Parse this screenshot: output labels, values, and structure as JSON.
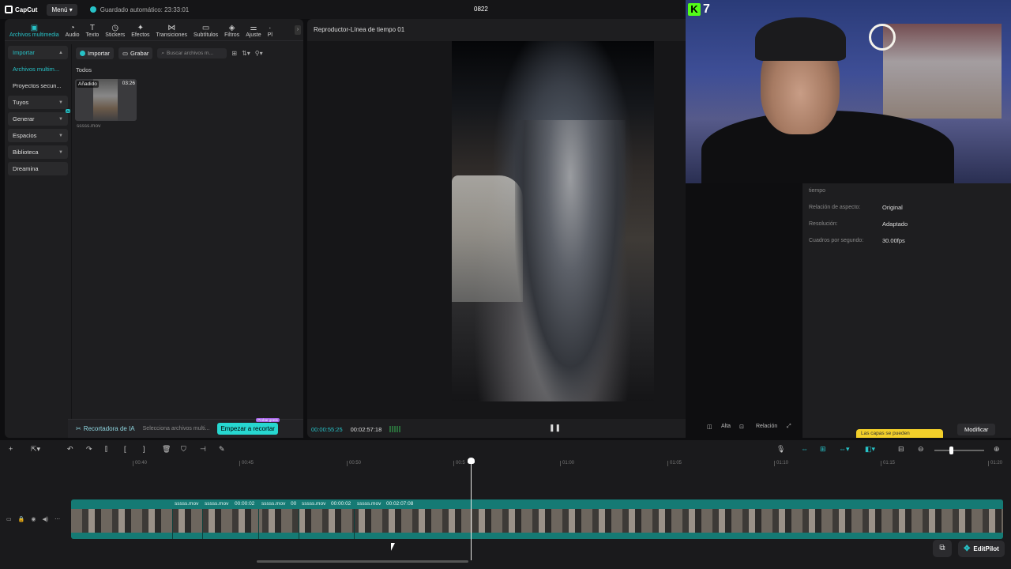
{
  "titlebar": {
    "logo": "CapCut",
    "menu": "Menú",
    "autosave": "Guardado automático: 23:33:01",
    "project": "0822"
  },
  "toolbar": {
    "items": [
      {
        "label": "Archivos multimedia",
        "icon": "media-icon"
      },
      {
        "label": "Audio",
        "icon": "audio-icon"
      },
      {
        "label": "Texto",
        "icon": "text-icon"
      },
      {
        "label": "Stickers",
        "icon": "sticker-icon"
      },
      {
        "label": "Efectos",
        "icon": "effects-icon"
      },
      {
        "label": "Transiciones",
        "icon": "transitions-icon"
      },
      {
        "label": "Subtítulos",
        "icon": "subtitles-icon"
      },
      {
        "label": "Filtros",
        "icon": "filters-icon"
      },
      {
        "label": "Ajuste",
        "icon": "adjust-icon"
      },
      {
        "label": "Pl",
        "icon": "plugin-icon"
      }
    ]
  },
  "sidenav": {
    "items": [
      {
        "label": "Importar"
      },
      {
        "label": "Archivos multim..."
      },
      {
        "label": "Proyectos secun..."
      },
      {
        "label": "Tuyos"
      },
      {
        "label": "Generar",
        "badge": "AI"
      },
      {
        "label": "Espacios"
      },
      {
        "label": "Biblioteca"
      },
      {
        "label": "Dreamina"
      }
    ]
  },
  "media": {
    "import_btn": "Importar",
    "record_btn": "Grabar",
    "search_placeholder": "Buscar archivos m...",
    "section": "Todos",
    "clip": {
      "badge": "Añadido",
      "duration": "03:26",
      "name": "sssss.mov"
    }
  },
  "ai_bar": {
    "title": "Recortadora de IA",
    "hint": "Selecciona archivos multi...",
    "button": "Empezar a recortar",
    "button_badge": "Probar gratis"
  },
  "player": {
    "title": "Reproductor-Línea de tiempo 01",
    "time_current": "00:00:55:25",
    "time_total": "00:02:57:18",
    "ctrl_ratio_a": "Alta",
    "ctrl_ratio_b": "Relación"
  },
  "webcam": {
    "kick_count": "7"
  },
  "props": {
    "rows": [
      {
        "label": "tiempo",
        "value": ""
      },
      {
        "label": "Relación de aspecto:",
        "value": "Original"
      },
      {
        "label": "Resolución:",
        "value": "Adaptado"
      },
      {
        "label": "Cuadros por segundo:",
        "value": "30.00fps"
      }
    ],
    "tooltip": "Las capas se pueden",
    "modify": "Modificar"
  },
  "timeline": {
    "ticks": [
      "00:40",
      "00:45",
      "00:50",
      "00:5",
      "01:00",
      "01:05",
      "01:10",
      "01:15",
      "01:20"
    ],
    "clip_labels": [
      "sssss.mov",
      "sssss.mov",
      "00:00:02",
      "sssss.mov",
      "00",
      "sssss.mov",
      "00:00:02",
      "sssss.mov",
      "00:02:07:08"
    ]
  },
  "editpilot": {
    "label": "EditPilot"
  }
}
